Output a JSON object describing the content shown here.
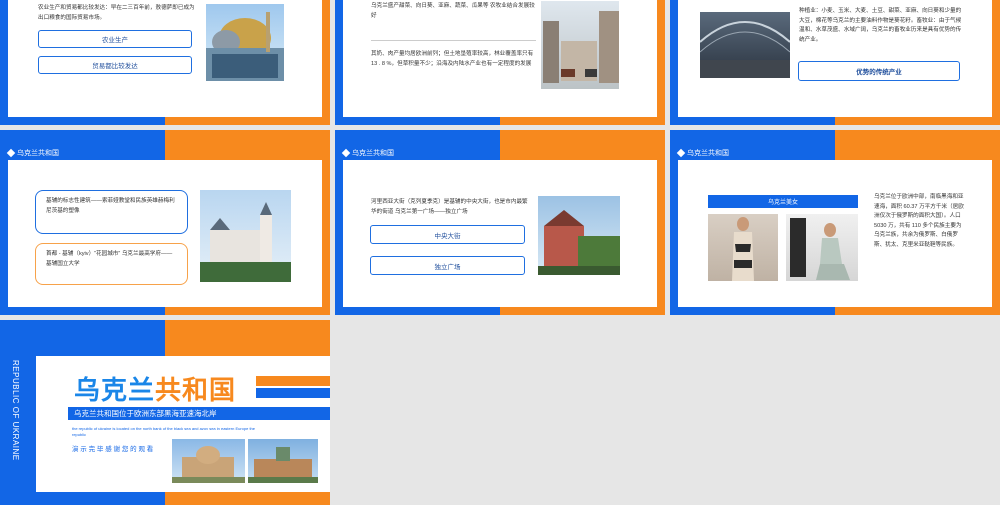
{
  "colors": {
    "blue": "#1266e6",
    "orange": "#f7891e"
  },
  "slide1": {
    "text": "农业生产和贸易都比较发达：早在二三百年前，敖德萨即已成为出口粮食的国际贸易市场。",
    "btn1": "农业生产",
    "btn2": "贸易都比较发达"
  },
  "slide2": {
    "text1": "乌克兰盛产甜菜、向日葵、亚麻、蔬菜、瓜果等 农牧业结合发展较好",
    "text2": "其奶、肉产量均居欧洲前列；但土地垦殖率较高，林业覆盖率只有 13 . 8 %，但草积量不少；沿海及内陆水产业也有一定程度的发展"
  },
  "slide3": {
    "text": "种植业：小麦、玉米、大麦、土豆、甜菜、亚麻、向日葵和少量的大豆，棉花等乌克兰的主要油料作物是葵花籽。畜牧业：由于气候温和、水草茂盛、水域广阔，乌克兰的畜牧业历来是具有优势的传统产业。",
    "btn": "优势的传统产业"
  },
  "slide4": {
    "section": "乌克兰共和国",
    "box1": "基辅的标志性建筑——索菲娅教堂和民族英雄赫梅利尼茨基的塑像",
    "box2": "首都 - 基辅（kyiv）“花园城市” 乌克兰最高学府——基辅国立大学"
  },
  "slide5": {
    "section": "乌克兰共和国",
    "text": "河里西亚大街（克列夏季克）是基辅的中央大街，也是市内最繁华的街道 乌克兰第一广场——独立广场",
    "btn1": "中央大街",
    "btn2": "独立广场"
  },
  "slide6": {
    "section": "乌克兰共和国",
    "banner": "乌克兰美女",
    "text": "乌克兰位于欧洲中部，南临黑海和亚速海，面积 60.37 万平方千米（居欧洲仅次于俄罗斯的面积大国）。人口 5030 万，共有 110 多个民族主要为乌克兰族，共余为俄罗斯、白俄罗斯、犹太、克里米亚鞑靼等民族。"
  },
  "slide7": {
    "vertical": "REPUBLIC OF UKRAINE",
    "title_a": "乌克兰",
    "title_b": "共和国",
    "subtitle": "乌克兰共和国位于欧洲东部黑海亚速海北岸",
    "english": "the republic of ukraine is located on the north bank of the black sea and azov sea in eastern Europe the republic",
    "thanks": "演 示 完 毕 感 谢 您 的 观 看"
  }
}
